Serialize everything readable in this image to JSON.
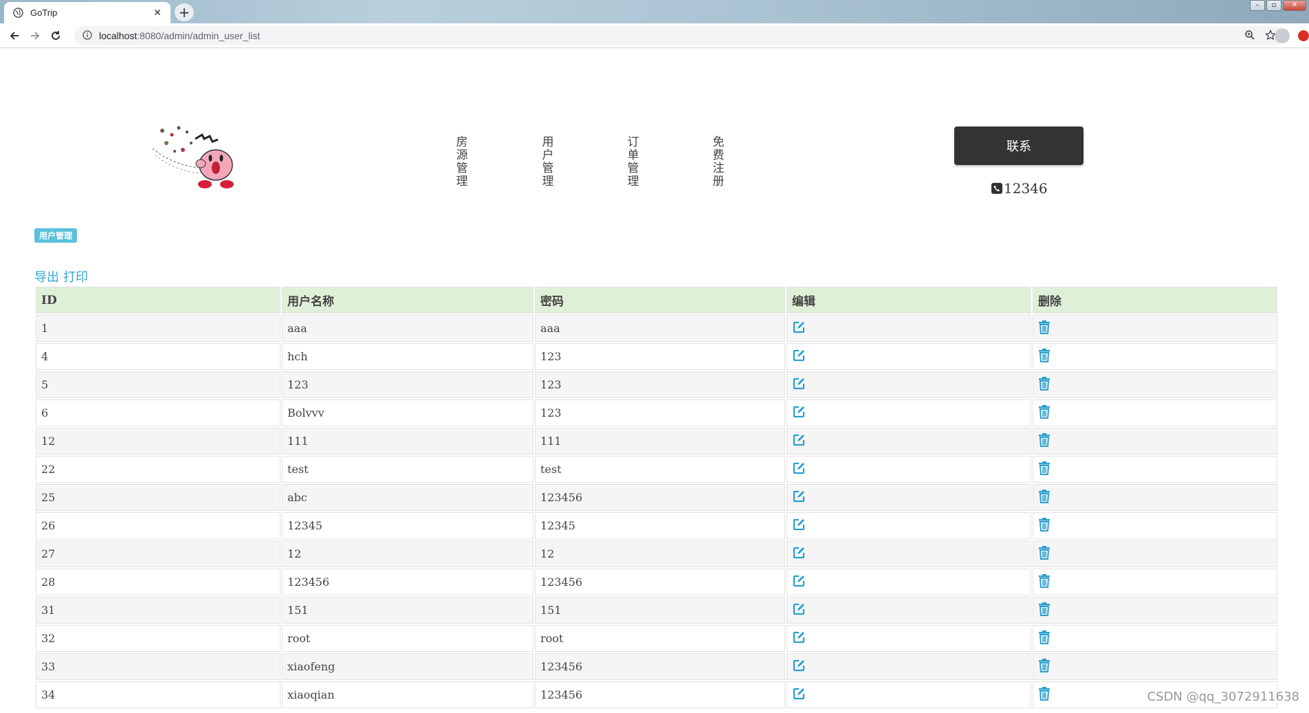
{
  "browser": {
    "tab_title": "GoTrip",
    "url_host": "localhost",
    "url_path": ":8080/admin/admin_user_list"
  },
  "header": {
    "nav": [
      "房源管理",
      "用户管理",
      "订单管理",
      "免费注册"
    ],
    "contact_label": "联系",
    "phone": "12346"
  },
  "page": {
    "badge": "用户管理",
    "export_label": "导出",
    "print_label": "打印"
  },
  "table": {
    "columns": [
      "ID",
      "用户名称",
      "密码",
      "编辑",
      "删除"
    ],
    "rows": [
      {
        "id": "1",
        "name": "aaa",
        "password": "aaa"
      },
      {
        "id": "4",
        "name": "hch",
        "password": "123"
      },
      {
        "id": "5",
        "name": "123",
        "password": "123"
      },
      {
        "id": "6",
        "name": "Bolvvv",
        "password": "123"
      },
      {
        "id": "12",
        "name": "111",
        "password": "111"
      },
      {
        "id": "22",
        "name": "test",
        "password": "test"
      },
      {
        "id": "25",
        "name": "abc",
        "password": "123456"
      },
      {
        "id": "26",
        "name": "12345",
        "password": "12345"
      },
      {
        "id": "27",
        "name": "12",
        "password": "12"
      },
      {
        "id": "28",
        "name": "123456",
        "password": "123456"
      },
      {
        "id": "31",
        "name": "151",
        "password": "151"
      },
      {
        "id": "32",
        "name": "root",
        "password": "root"
      },
      {
        "id": "33",
        "name": "xiaofeng",
        "password": "123456"
      },
      {
        "id": "34",
        "name": "xiaoqian",
        "password": "123456"
      }
    ]
  },
  "icons": {
    "edit": "edit-icon",
    "delete": "trash-icon"
  },
  "colors": {
    "accent": "#31a5d3",
    "header_row": "#dff0d8",
    "badge": "#5bc0de",
    "contact_button": "#333333"
  },
  "watermark": "CSDN @qq_3072911638"
}
